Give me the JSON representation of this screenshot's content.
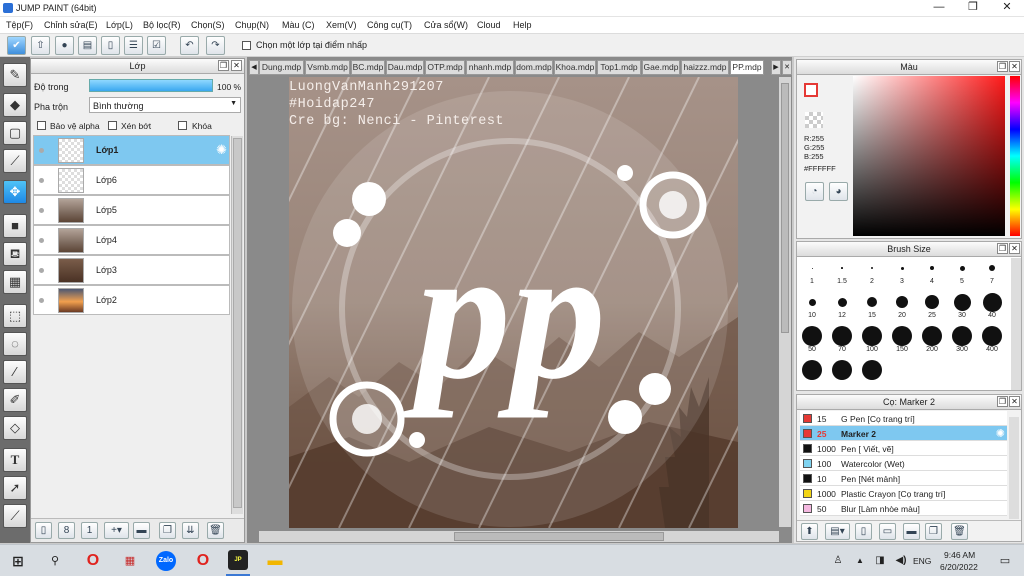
{
  "app": {
    "title": "JUMP PAINT (64bit)",
    "window_buttons": [
      "—",
      "❐",
      "✕"
    ]
  },
  "menu": [
    "Tệp(F)",
    "Chỉnh sửa(E)",
    "Lớp(L)",
    "Bộ lọc(R)",
    "Chọn(S)",
    "Chụp(N)",
    "Màu (C)",
    "Xem(V)",
    "Công cụ(T)",
    "Cửa sổ(W)",
    "Cloud",
    "Help"
  ],
  "toolbar": {
    "icons": [
      "pen-tablet",
      "export",
      "comment",
      "message",
      "document",
      "layers",
      "checklist",
      "undo",
      "redo"
    ],
    "checkbox_label": "Chọn một lớp tại điểm nhấp"
  },
  "tools": [
    "pen",
    "eraser",
    "select-rect",
    "line",
    "move",
    "fill-rect",
    "bucket",
    "gradient",
    "lasso-rect",
    "lasso",
    "magic-wand",
    "select-pen",
    "select-eraser",
    "text",
    "operation",
    "eyedropper"
  ],
  "layer_panel": {
    "title": "Lớp",
    "opacity_label": "Độ trong",
    "opacity_value": "100 %",
    "opacity_fraction": 1.0,
    "blend_label": "Pha trộn",
    "blend_value": "Bình thường",
    "options": [
      "Bảo vệ alpha",
      "Xén bớt",
      "Khóa"
    ],
    "layers": [
      {
        "name": "Lớp1",
        "selected": true,
        "thumb": "transparent"
      },
      {
        "name": "Lớp6",
        "selected": false,
        "thumb": "transparent"
      },
      {
        "name": "Lớp5",
        "selected": false,
        "thumb": "brown"
      },
      {
        "name": "Lớp4",
        "selected": false,
        "thumb": "brown"
      },
      {
        "name": "Lớp3",
        "selected": false,
        "thumb": "darkbrown"
      },
      {
        "name": "Lớp2",
        "selected": false,
        "thumb": "sunset"
      }
    ]
  },
  "doc_tabs": [
    "Dung.mdp",
    "Vsmb.mdp",
    "BC.mdp",
    "Dau.mdp",
    "OTP.mdp",
    "nhanh.mdp",
    "dom.mdp",
    "Khoa.mdp",
    "Top1.mdp",
    "Gae.mdp",
    "haizzz.mdp",
    "PP.mdp"
  ],
  "active_tab": "PP.mdp",
  "canvas": {
    "watermark_lines": [
      "LuongVanManh291207",
      "#Hoidap247",
      "Cre bg: Nenci - Pinterest"
    ],
    "logo_text": "pp"
  },
  "color_panel": {
    "title": "Màu",
    "r": "R:255",
    "g": "G:255",
    "b": "B:255",
    "hex": "#FFFFFF"
  },
  "brush_size_panel": {
    "title": "Brush Size",
    "sizes": [
      "1",
      "1.5",
      "2",
      "3",
      "4",
      "5",
      "7",
      "10",
      "12",
      "15",
      "20",
      "25",
      "30",
      "40",
      "50",
      "70",
      "100",
      "150",
      "200",
      "300",
      "400",
      "",
      "",
      ""
    ]
  },
  "brush_panel": {
    "title": "Cọ: Marker 2",
    "brushes": [
      {
        "size": "15",
        "label": "G Pen [Cọ trang trí]",
        "color": "#e53935",
        "selected": false
      },
      {
        "size": "25",
        "label": "Marker 2",
        "color": "#e53935",
        "selected": true
      },
      {
        "size": "1000",
        "label": "Pen [ Viết, vẽ]",
        "color": "#111111",
        "selected": false
      },
      {
        "size": "100",
        "label": "Watercolor (Wet)",
        "color": "#7fd3f0",
        "selected": false
      },
      {
        "size": "10",
        "label": "Pen [Nét mảnh]",
        "color": "#111111",
        "selected": false
      },
      {
        "size": "1000",
        "label": "Plastic Crayon [Cọ trang trí]",
        "color": "#f2d516",
        "selected": false
      },
      {
        "size": "50",
        "label": "Blur [Làm nhòe màu]",
        "color": "#f4b8e0",
        "selected": false
      }
    ]
  },
  "taskbar": {
    "lang": "ENG",
    "time": "9:46 AM",
    "date": "6/20/2022",
    "apps": [
      "Opera",
      "App",
      "Zalo",
      "Opera",
      "JUMP PAINT",
      "Explorer"
    ]
  }
}
